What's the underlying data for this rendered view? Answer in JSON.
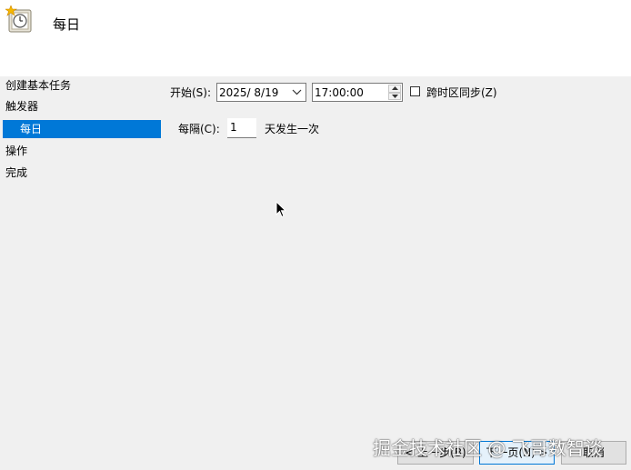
{
  "header": {
    "title": "每日"
  },
  "sidebar": {
    "items": [
      {
        "label": "创建基本任务"
      },
      {
        "label": "触发器"
      },
      {
        "label": "每日"
      },
      {
        "label": "操作"
      },
      {
        "label": "完成"
      }
    ]
  },
  "form": {
    "start_label": "开始(S):",
    "start_date": "2025/  8/19",
    "start_time": "17:00:00",
    "sync_label": "跨时区同步(Z)",
    "recur_label": "每隔(C):",
    "recur_value": "1",
    "recur_unit": "天发生一次"
  },
  "buttons": {
    "back": "< 上一步(B)",
    "next": "下一页(N) >",
    "cancel": "取消"
  },
  "watermark": "掘金技术社区 @ 飞哥数智谈",
  "colors": {
    "accent": "#0078d7"
  }
}
